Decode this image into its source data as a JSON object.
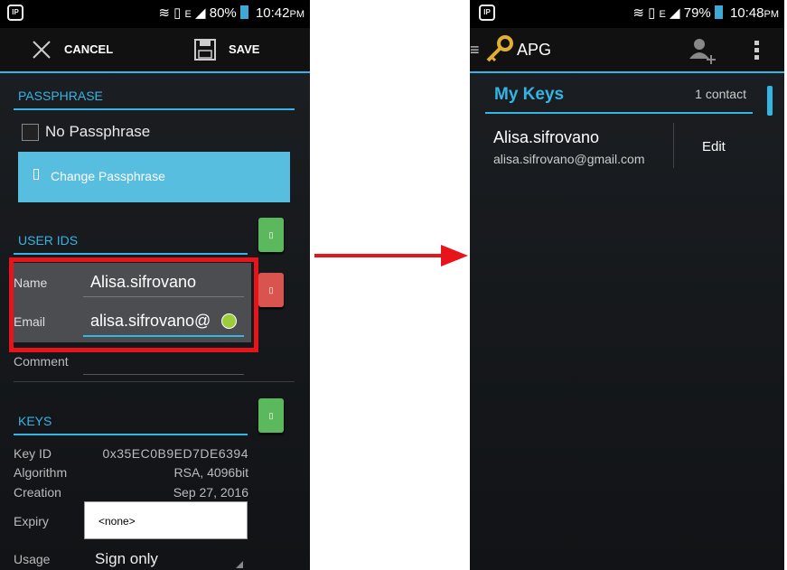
{
  "left": {
    "status": {
      "left_icon": "sip-icon",
      "battery": "80%",
      "time": "10:42",
      "ampm": "PM",
      "net": "E"
    },
    "toolbar": {
      "cancel_label": "CANCEL",
      "save_label": "SAVE"
    },
    "passphrase": {
      "section_title": "PASSPHRASE",
      "checkbox_label": "No Passphrase",
      "change_button": "Change Passphrase"
    },
    "user_ids": {
      "section_title": "USER IDS",
      "name_label": "Name",
      "name_value": "Alisa.sifrovano",
      "email_label": "Email",
      "email_value": "alisa.sifrovano@",
      "comment_label": "Comment",
      "comment_value": ""
    },
    "keys": {
      "section_title": "KEYS",
      "rows": [
        {
          "label": "Key ID",
          "value": "0x35EC0B9ED7DE6394"
        },
        {
          "label": "Algorithm",
          "value": "RSA, 4096bit"
        },
        {
          "label": "Creation",
          "value": "Sep 27, 2016"
        }
      ],
      "expiry_label": "Expiry",
      "expiry_value": "<none>",
      "usage_label": "Usage",
      "usage_value": "Sign only"
    }
  },
  "right": {
    "status": {
      "left_icon": "sip-icon",
      "battery": "79%",
      "time": "10:48",
      "ampm": "PM",
      "net": "E"
    },
    "app_title": "APG",
    "list_header": {
      "title": "My Keys",
      "count": "1 contact"
    },
    "key_item": {
      "name": "Alisa.sifrovano",
      "email": "alisa.sifrovano@gmail.com",
      "edit_label": "Edit"
    }
  },
  "colors": {
    "accent": "#33b5e5",
    "arrow": "#e8141b",
    "highlight_box": "#e8141b",
    "button_blue": "#58bedf",
    "green": "#5cb85c",
    "red": "#d9534f"
  }
}
